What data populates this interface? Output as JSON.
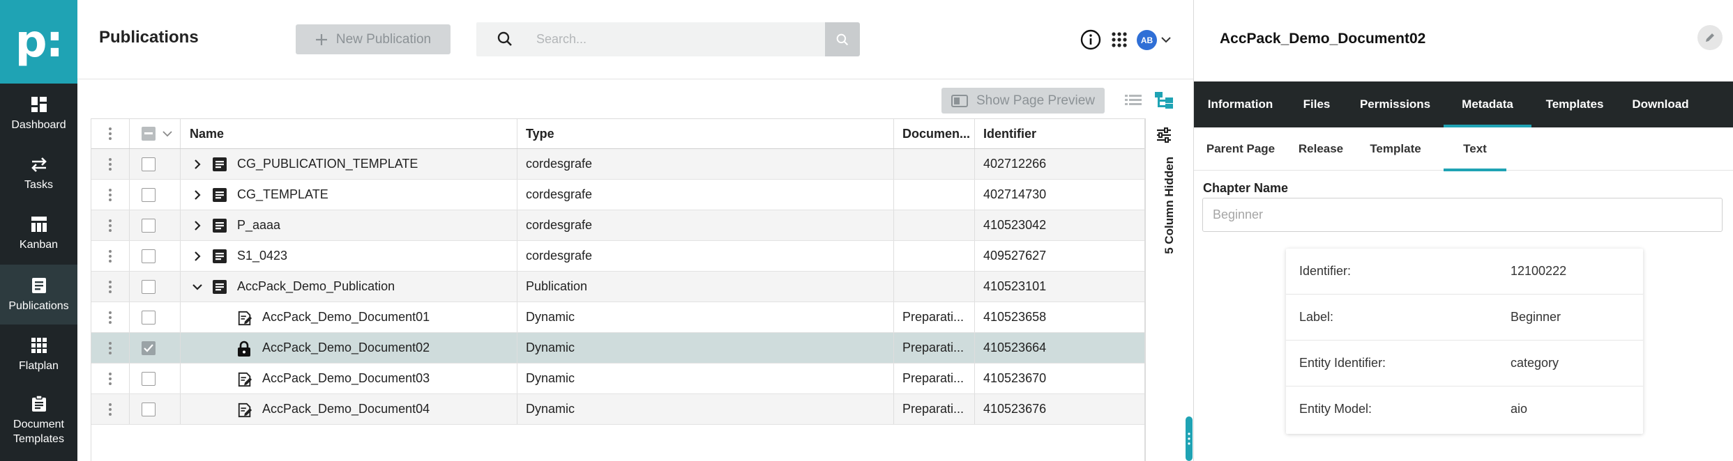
{
  "sidebar": {
    "logo": "p:",
    "items": [
      {
        "label": "Dashboard",
        "icon": "dashboard-icon"
      },
      {
        "label": "Tasks",
        "icon": "tasks-icon"
      },
      {
        "label": "Kanban",
        "icon": "kanban-icon"
      },
      {
        "label": "Publications",
        "icon": "publications-icon",
        "active": true
      },
      {
        "label": "Flatplan",
        "icon": "flatplan-icon"
      },
      {
        "label": "Document Templates",
        "icon": "document-templates-icon"
      }
    ]
  },
  "header": {
    "title": "Publications",
    "new_button_label": "New Publication",
    "search_placeholder": "Search...",
    "avatar_initials": "AB"
  },
  "toolbar": {
    "preview_label": "Show Page Preview"
  },
  "table": {
    "columns": [
      "Name",
      "Type",
      "Documen...",
      "Identifier"
    ],
    "hidden_columns_label": "5 Column Hidden",
    "rows": [
      {
        "name": "CG_PUBLICATION_TEMPLATE",
        "type": "cordesgrafe",
        "doc": "",
        "identifier": "402712266",
        "level": 0,
        "expand": "collapsed",
        "icon": "publication-icon"
      },
      {
        "name": "CG_TEMPLATE",
        "type": "cordesgrafe",
        "doc": "",
        "identifier": "402714730",
        "level": 0,
        "expand": "collapsed",
        "icon": "publication-icon"
      },
      {
        "name": "P_aaaa",
        "type": "cordesgrafe",
        "doc": "",
        "identifier": "410523042",
        "level": 0,
        "expand": "collapsed",
        "icon": "publication-icon"
      },
      {
        "name": "S1_0423",
        "type": "cordesgrafe",
        "doc": "",
        "identifier": "409527627",
        "level": 0,
        "expand": "collapsed",
        "icon": "publication-icon"
      },
      {
        "name": "AccPack_Demo_Publication",
        "type": "Publication",
        "doc": "",
        "identifier": "410523101",
        "level": 0,
        "expand": "expanded",
        "icon": "publication-icon"
      },
      {
        "name": "AccPack_Demo_Document01",
        "type": "Dynamic",
        "doc": "Preparati...",
        "identifier": "410523658",
        "level": 1,
        "icon": "document-edit-icon"
      },
      {
        "name": "AccPack_Demo_Document02",
        "type": "Dynamic",
        "doc": "Preparati...",
        "identifier": "410523664",
        "level": 1,
        "icon": "lock-icon",
        "selected": true
      },
      {
        "name": "AccPack_Demo_Document03",
        "type": "Dynamic",
        "doc": "Preparati...",
        "identifier": "410523670",
        "level": 1,
        "icon": "document-edit-icon"
      },
      {
        "name": "AccPack_Demo_Document04",
        "type": "Dynamic",
        "doc": "Preparati...",
        "identifier": "410523676",
        "level": 1,
        "icon": "document-edit-icon"
      }
    ]
  },
  "panel": {
    "title": "AccPack_Demo_Document02",
    "tabs": [
      "Information",
      "Files",
      "Permissions",
      "Metadata",
      "Templates",
      "Download"
    ],
    "active_tab": "Metadata",
    "subtabs": [
      "Parent Page",
      "Release",
      "Template",
      "Text"
    ],
    "active_subtab": "Text",
    "field_label": "Chapter Name",
    "field_placeholder": "Beginner",
    "info": [
      {
        "key": "Identifier:",
        "value": "12100222"
      },
      {
        "key": "Label:",
        "value": "Beginner"
      },
      {
        "key": "Entity Identifier:",
        "value": "category"
      },
      {
        "key": "Entity Model:",
        "value": "aio"
      }
    ]
  },
  "colors": {
    "accent": "#1fa3b4",
    "sidebar": "#1f2528",
    "tabs_bg": "#232829",
    "selected_row": "#cfdcdc"
  }
}
